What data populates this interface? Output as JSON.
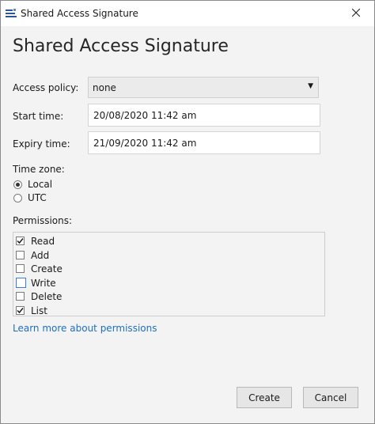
{
  "window": {
    "title": "Shared Access Signature",
    "heading": "Shared Access Signature"
  },
  "form": {
    "access_policy_label": "Access policy:",
    "access_policy_value": "none",
    "start_time_label": "Start time:",
    "start_time_value": "20/08/2020 11:42 am",
    "expiry_time_label": "Expiry time:",
    "expiry_time_value": "21/09/2020 11:42 am",
    "time_zone_label": "Time zone:",
    "time_zone_options": [
      {
        "label": "Local",
        "selected": true
      },
      {
        "label": "UTC",
        "selected": false
      }
    ],
    "permissions_label": "Permissions:",
    "permissions": [
      {
        "label": "Read",
        "checked": true
      },
      {
        "label": "Add",
        "checked": false
      },
      {
        "label": "Create",
        "checked": false
      },
      {
        "label": "Write",
        "checked": false
      },
      {
        "label": "Delete",
        "checked": false
      },
      {
        "label": "List",
        "checked": true
      }
    ],
    "learn_more_link": "Learn more about permissions"
  },
  "buttons": {
    "create": "Create",
    "cancel": "Cancel"
  },
  "icons": {
    "app": "storage-explorer-icon",
    "close": "close-icon",
    "dropdown": "chevron-down-icon",
    "check": "checkmark-icon"
  },
  "colors": {
    "link": "#1f6fbf",
    "focus": "#3b7fd4"
  }
}
